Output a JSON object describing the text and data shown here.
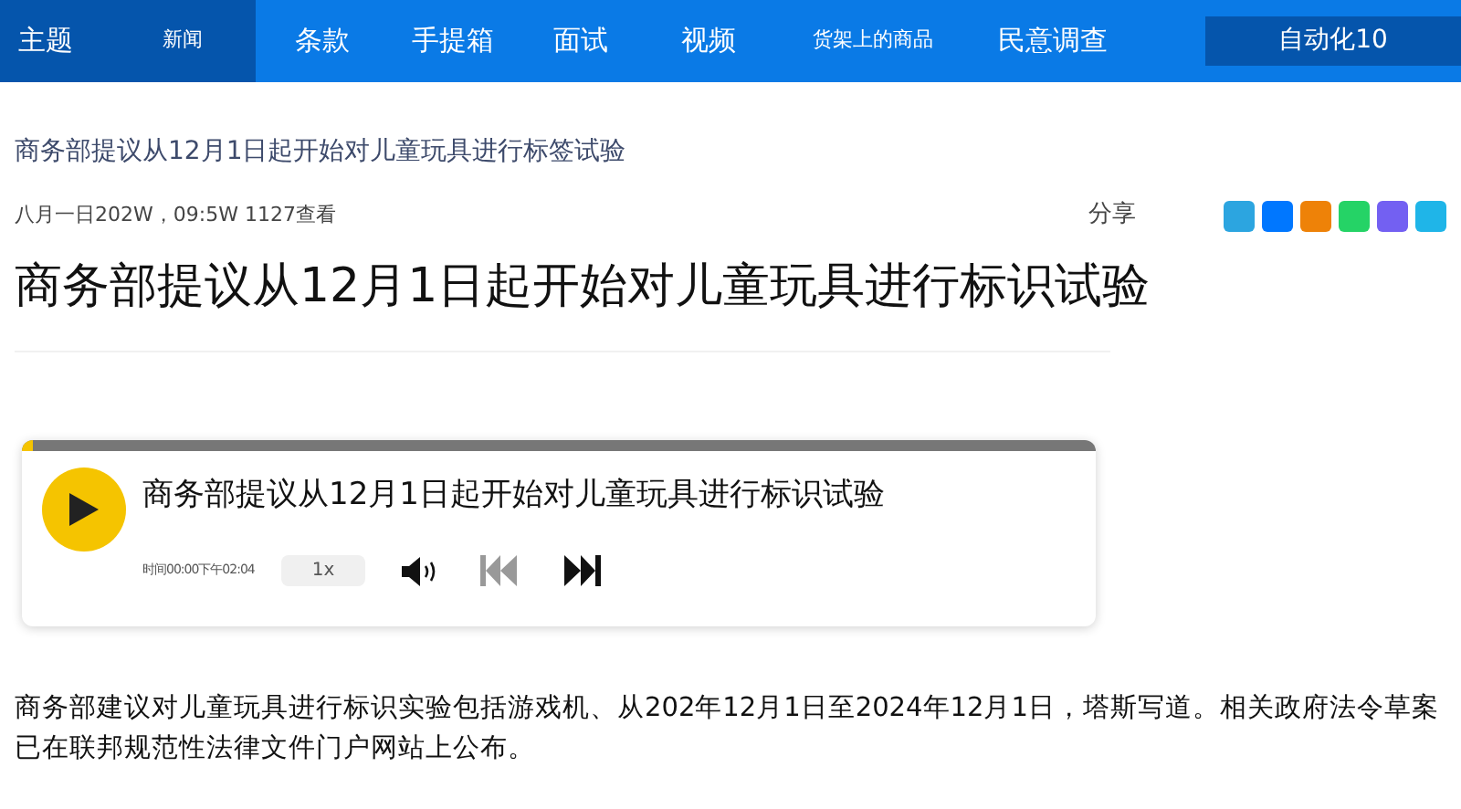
{
  "nav": {
    "title": "主题",
    "items": [
      {
        "label": "新闻",
        "selected": true
      },
      {
        "label": "条款",
        "selected": false
      },
      {
        "label": "手提箱",
        "selected": false
      },
      {
        "label": "面试",
        "selected": false
      },
      {
        "label": "视频",
        "selected": false
      },
      {
        "label": "货架上的商品",
        "selected": false
      },
      {
        "label": "民意调查",
        "selected": false
      }
    ],
    "button": "自动化10"
  },
  "article": {
    "kicker": "商务部提议从12月1日起开始对儿童玩具进行标签试验",
    "meta": "八月一日202W，09:5W 1127查看",
    "share_label": "分享",
    "share": [
      {
        "color": "#2ca5e0"
      },
      {
        "color": "#0077ff"
      },
      {
        "color": "#ee8208"
      },
      {
        "color": "#25d366"
      },
      {
        "color": "#7360f2"
      },
      {
        "color": "#1fb5e8"
      }
    ],
    "headline": "商务部提议从12月1日起开始对儿童玩具进行标识试验",
    "player": {
      "title": "商务部提议从12月1日起开始对儿童玩具进行标识试验",
      "level": 0.01,
      "time": "时间00:00下午02:04",
      "speed": "1x"
    },
    "body": "商务部建议对儿童玩具进行标识实验包括游戏机、从202年12月1日至2024年12月1日，塔斯写道。相关政府法令草案已在联邦规范性法律文件门户网站上公布。"
  }
}
